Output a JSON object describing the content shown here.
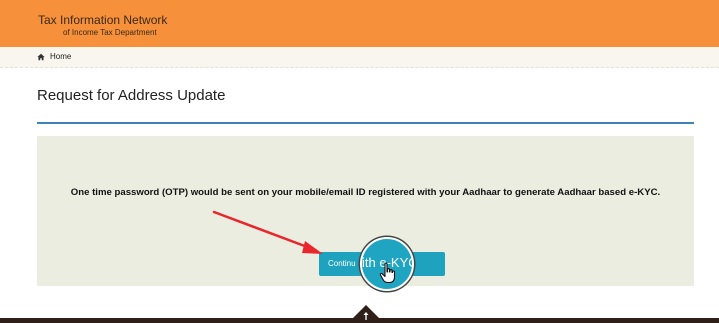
{
  "header": {
    "title": "Tax Information Network",
    "subtitle": "of Income Tax Department",
    "background_color": "#f6903a"
  },
  "breadcrumb": {
    "home_label": "Home",
    "home_icon": "home-icon"
  },
  "page": {
    "title": "Request for Address Update",
    "rule_color": "#3b86b6"
  },
  "panel": {
    "message": "One time password (OTP) would be sent on your mobile/email ID registered with your Aadhaar to generate Aadhaar based e-KYC.",
    "background_color": "#ebede0"
  },
  "continue_button": {
    "label": "Continu",
    "magnified_label": "ith e-KYC",
    "color": "#1ea2bd"
  },
  "annotation": {
    "arrow_color": "#e8262b"
  },
  "footer": {
    "scroll_top_icon": "arrow-up-icon",
    "color": "#2e2019"
  }
}
